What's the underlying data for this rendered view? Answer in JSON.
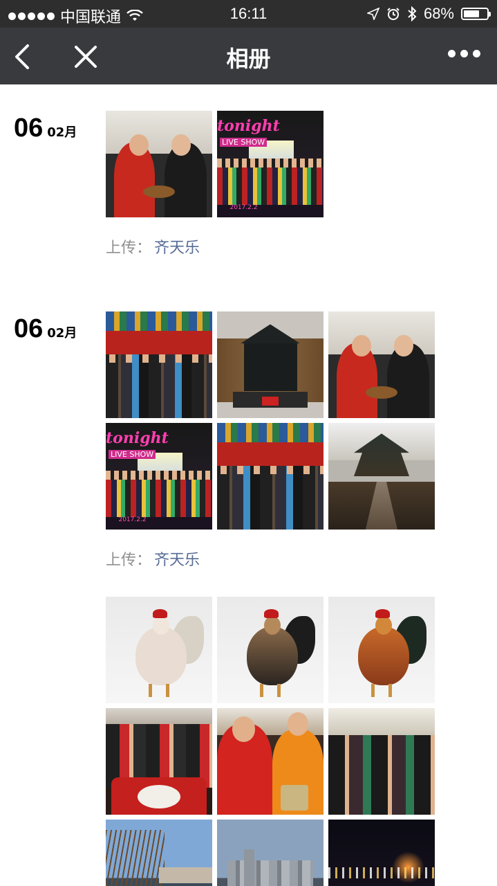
{
  "status_bar": {
    "carrier": "中国联通",
    "time": "16:11",
    "battery_percent_text": "68%",
    "battery_level": 0.68,
    "icons": [
      "signal-dots-icon",
      "wifi-icon",
      "location-arrow-icon",
      "alarm-icon",
      "bluetooth-icon",
      "battery-icon"
    ]
  },
  "nav": {
    "title": "相册",
    "back_icon": "chevron-left-icon",
    "close_icon": "close-icon",
    "more_icon": "more-dots-icon"
  },
  "posts": [
    {
      "day": "06",
      "month": "02月",
      "photos": [
        "portrait-two-men",
        "tonight-group"
      ],
      "uploader_label": "上传：",
      "uploader_name": "齐天乐"
    },
    {
      "day": "06",
      "month": "02月",
      "photos": [
        "group-red-hall",
        "temple-model",
        "portrait-two-men",
        "tonight-group",
        "group-red-hall",
        "temple-hall"
      ],
      "uploader_label": "上传：",
      "uploader_name": "齐天乐"
    },
    {
      "photos": [
        "rooster-white",
        "rooster-dark",
        "rooster-red",
        "dumpling-table",
        "aprons-cooking",
        "dining-crowd",
        "river-trees",
        "city-skyline",
        "night-street"
      ]
    }
  ],
  "photo_captions": {
    "tonight_sign": "tonight",
    "tonight_sub": "LIVE SHOW",
    "tonight_date": "2017.2.2"
  },
  "colors": {
    "statusbar_bg": "#2e2e2e",
    "navbar_bg": "#393a3e",
    "link": "#576b95",
    "muted": "#8f8f8f"
  }
}
